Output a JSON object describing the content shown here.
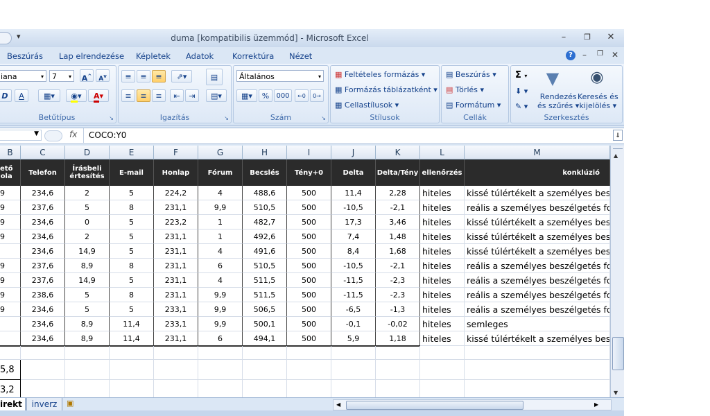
{
  "window": {
    "title": "duma  [kompatibilis üzemmód] - Microsoft Excel"
  },
  "ribbon_tabs": [
    "Beszúrás",
    "Lap elrendezése",
    "Képletek",
    "Adatok",
    "Korrektúra",
    "Nézet"
  ],
  "ribbon": {
    "font": {
      "name": "iana",
      "size": "7",
      "group_label": "Betűtípus"
    },
    "alignment": {
      "group_label": "Igazítás"
    },
    "number": {
      "format": "Általános",
      "percent": "%",
      "thousands": "000",
      "group_label": "Szám"
    },
    "styles": {
      "conditional": "Feltételes formázás",
      "format_table": "Formázás táblázatként",
      "cell_styles": "Cellastílusok",
      "group_label": "Stílusok"
    },
    "cells": {
      "insert": "Beszúrás",
      "delete": "Törlés",
      "format": "Formátum",
      "group_label": "Cellák"
    },
    "editing": {
      "sigma": "Σ",
      "sort_line1": "Rendezés",
      "sort_line2": "és szűrés",
      "find_line1": "Keresés és",
      "find_line2": "kijelölés",
      "group_label": "Szerkesztés"
    }
  },
  "formula_bar": {
    "fx": "fx",
    "content": "COCO:Y0"
  },
  "columns": [
    "B",
    "C",
    "D",
    "E",
    "F",
    "G",
    "H",
    "I",
    "J",
    "K",
    "L",
    "M"
  ],
  "table_header": [
    "ető\nola",
    "Telefon",
    "Írásbeli\nértesítés",
    "E-mail",
    "Honlap",
    "Fórum",
    "Becslés",
    "Tény+0",
    "Delta",
    "Delta/Tény",
    "ellenőrzés",
    "konklúzió"
  ],
  "rows": [
    [
      "9",
      "234,6",
      "2",
      "5",
      "224,2",
      "4",
      "488,6",
      "500",
      "11,4",
      "2,28",
      "hiteles",
      "kissé túlértékelt a személyes besz"
    ],
    [
      "9",
      "237,6",
      "5",
      "8",
      "231,1",
      "9,9",
      "510,5",
      "500",
      "-10,5",
      "-2,1",
      "hiteles",
      "reális a személyes beszélgetés for"
    ],
    [
      "9",
      "234,6",
      "0",
      "5",
      "223,2",
      "1",
      "482,7",
      "500",
      "17,3",
      "3,46",
      "hiteles",
      "kissé túlértékelt a személyes besz"
    ],
    [
      "9",
      "234,6",
      "2",
      "5",
      "231,1",
      "1",
      "492,6",
      "500",
      "7,4",
      "1,48",
      "hiteles",
      "kissé túlértékelt a személyes besz"
    ],
    [
      "",
      "234,6",
      "14,9",
      "5",
      "231,1",
      "4",
      "491,6",
      "500",
      "8,4",
      "1,68",
      "hiteles",
      "kissé túlértékelt a személyes besz"
    ],
    [
      "9",
      "237,6",
      "8,9",
      "8",
      "231,1",
      "6",
      "510,5",
      "500",
      "-10,5",
      "-2,1",
      "hiteles",
      "reális a személyes beszélgetés for"
    ],
    [
      "9",
      "237,6",
      "14,9",
      "5",
      "231,1",
      "4",
      "511,5",
      "500",
      "-11,5",
      "-2,3",
      "hiteles",
      "reális a személyes beszélgetés for"
    ],
    [
      "9",
      "238,6",
      "5",
      "8",
      "231,1",
      "9,9",
      "511,5",
      "500",
      "-11,5",
      "-2,3",
      "hiteles",
      "reális a személyes beszélgetés for"
    ],
    [
      "9",
      "234,6",
      "5",
      "5",
      "233,1",
      "9,9",
      "506,5",
      "500",
      "-6,5",
      "-1,3",
      "hiteles",
      "reális a személyes beszélgetés for"
    ],
    [
      "",
      "234,6",
      "8,9",
      "11,4",
      "233,1",
      "9,9",
      "500,1",
      "500",
      "-0,1",
      "-0,02",
      "hiteles",
      "semleges"
    ],
    [
      "",
      "234,6",
      "8,9",
      "11,4",
      "231,1",
      "6",
      "494,1",
      "500",
      "5,9",
      "1,18",
      "hiteles",
      "kissé túlértékelt a személyes besz"
    ]
  ],
  "extra_cells": [
    "5,8",
    "3,2"
  ],
  "sheet_tabs": [
    "irekt",
    "inverz"
  ]
}
